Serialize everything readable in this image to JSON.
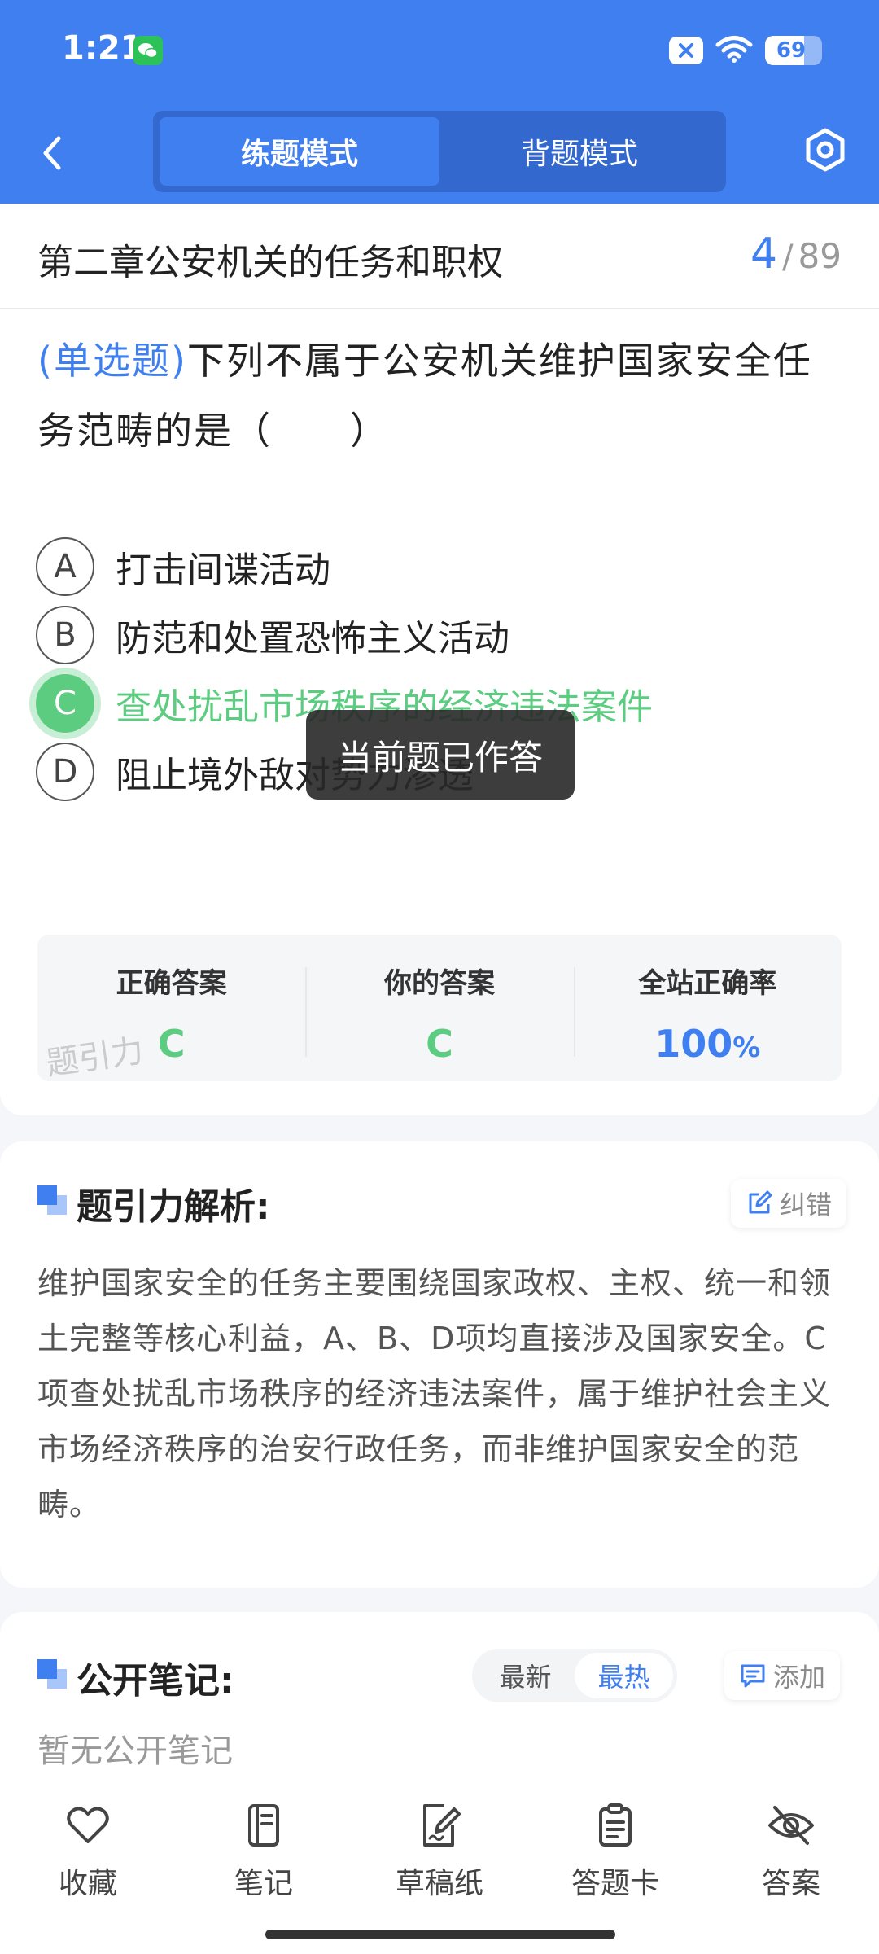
{
  "status_bar": {
    "time": "1:21",
    "battery": "69",
    "battery_level": 0.69
  },
  "mode_switch": {
    "tabs": [
      {
        "label": "练题模式",
        "active": true
      },
      {
        "label": "背题模式",
        "active": false
      }
    ]
  },
  "chapter": {
    "title": "第二章公安机关的任务和职权",
    "current": "4",
    "separator": "/",
    "total": "89"
  },
  "question": {
    "type_label": "(单选题)",
    "text": "下列不属于公安机关维护国家安全任务范畴的是（　　）",
    "options": [
      {
        "letter": "A",
        "text": "打击间谍活动"
      },
      {
        "letter": "B",
        "text": "防范和处置恐怖主义活动"
      },
      {
        "letter": "C",
        "text": "查处扰乱市场秩序的经济违法案件"
      },
      {
        "letter": "D",
        "text": "阻止境外敌对势力渗透"
      }
    ]
  },
  "answer_box": {
    "correct_label": "正确答案",
    "correct_value": "C",
    "yours_label": "你的答案",
    "yours_value": "C",
    "rate_label": "全站正确率",
    "rate_value": "100",
    "rate_unit": "%",
    "watermark": "题引力"
  },
  "toast": "当前题已作答",
  "analysis": {
    "title": "题引力解析:",
    "report_label": "纠错",
    "text": "维护国家安全的任务主要围绕国家政权、主权、统一和领土完整等核心利益，A、B、D项均直接涉及国家安全。C项查处扰乱市场秩序的经济违法案件，属于维护社会主义市场经济秩序的治安行政任务，而非维护国家安全的范畴。"
  },
  "notes": {
    "title": "公开笔记:",
    "sort_options": [
      {
        "label": "最新",
        "active": false
      },
      {
        "label": "最热",
        "active": true
      }
    ],
    "add_label": "添加",
    "empty_text": "暂无公开笔记"
  },
  "bottom_bar": {
    "items": [
      {
        "label": "收藏",
        "icon": "heart-icon"
      },
      {
        "label": "笔记",
        "icon": "notebook-icon"
      },
      {
        "label": "草稿纸",
        "icon": "draft-paper-icon"
      },
      {
        "label": "答题卡",
        "icon": "answer-card-icon"
      },
      {
        "label": "答案",
        "icon": "eye-off-icon"
      }
    ]
  },
  "colors": {
    "primary": "#3f7ff0",
    "correct": "#5ccc80",
    "background": "#f4f6fa"
  }
}
